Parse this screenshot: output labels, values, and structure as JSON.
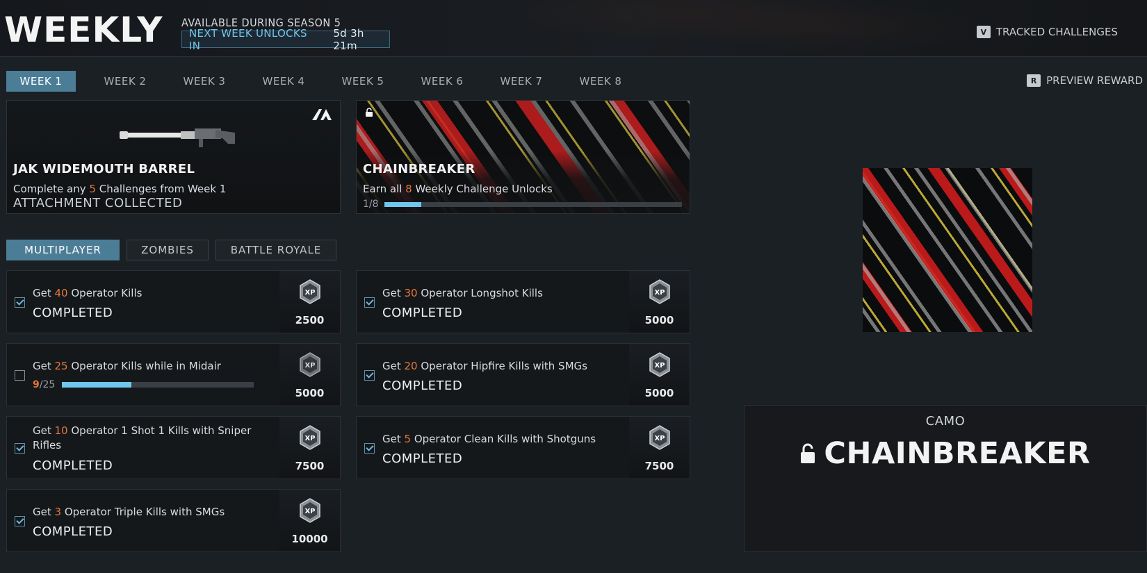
{
  "header": {
    "title": "WEEKLY",
    "season_text": "AVAILABLE DURING SEASON 5",
    "unlock_label": "NEXT WEEK UNLOCKS IN",
    "unlock_time": "5d 3h 21m",
    "tracked_key": "V",
    "tracked_label": "TRACKED CHALLENGES"
  },
  "weeks": [
    "WEEK 1",
    "WEEK 2",
    "WEEK 3",
    "WEEK 4",
    "WEEK 5",
    "WEEK 6",
    "WEEK 7",
    "WEEK 8"
  ],
  "active_week": 0,
  "preview": {
    "key": "R",
    "label": "PREVIEW REWARD"
  },
  "rewards": {
    "left": {
      "title": "JAK WIDEMOUTH BARREL",
      "desc_pre": "Complete any ",
      "desc_num": "5",
      "desc_post": " Challenges from Week 1",
      "status": "ATTACHMENT COLLECTED",
      "brand_icon": "A"
    },
    "right": {
      "title": "CHAINBREAKER",
      "desc_pre": "Earn all ",
      "desc_num": "8",
      "desc_post": " Weekly Challenge Unlocks",
      "progress_text": "1/8",
      "progress_fraction": 0.125
    }
  },
  "modes": [
    "MULTIPLAYER",
    "ZOMBIES",
    "BATTLE ROYALE"
  ],
  "active_mode": 0,
  "challenges": [
    {
      "pre": "Get ",
      "num": "40",
      "post": " Operator Kills",
      "status": "COMPLETED",
      "xp": "2500",
      "done": true
    },
    {
      "pre": "Get ",
      "num": "30",
      "post": " Operator Longshot Kills",
      "status": "COMPLETED",
      "xp": "5000",
      "done": true
    },
    {
      "pre": "Get ",
      "num": "25",
      "post": " Operator Kills while in Midair",
      "progress_cur": "9",
      "progress_tot": "/25",
      "progress_fraction": 0.36,
      "xp": "5000",
      "done": false,
      "locked": true
    },
    {
      "pre": "Get ",
      "num": "20",
      "post": " Operator Hipfire Kills with SMGs",
      "status": "COMPLETED",
      "xp": "5000",
      "done": true
    },
    {
      "pre": "Get ",
      "num": "10",
      "post": " Operator 1 Shot 1 Kills with Sniper Rifles",
      "status": "COMPLETED",
      "xp": "7500",
      "done": true
    },
    {
      "pre": "Get ",
      "num": "5",
      "post": " Operator Clean Kills with Shotguns",
      "status": "COMPLETED",
      "xp": "7500",
      "done": true
    },
    {
      "pre": "Get ",
      "num": "3",
      "post": " Operator Triple Kills with SMGs",
      "status": "COMPLETED",
      "xp": "10000",
      "done": true
    }
  ],
  "xp_label": "XP",
  "detail": {
    "type": "CAMO",
    "name": "CHAINBREAKER"
  },
  "colors": {
    "accent": "#4c7d97",
    "highlight": "#e6773b",
    "progress": "#6fc7ee",
    "unlock_text": "#6ec5ea"
  }
}
